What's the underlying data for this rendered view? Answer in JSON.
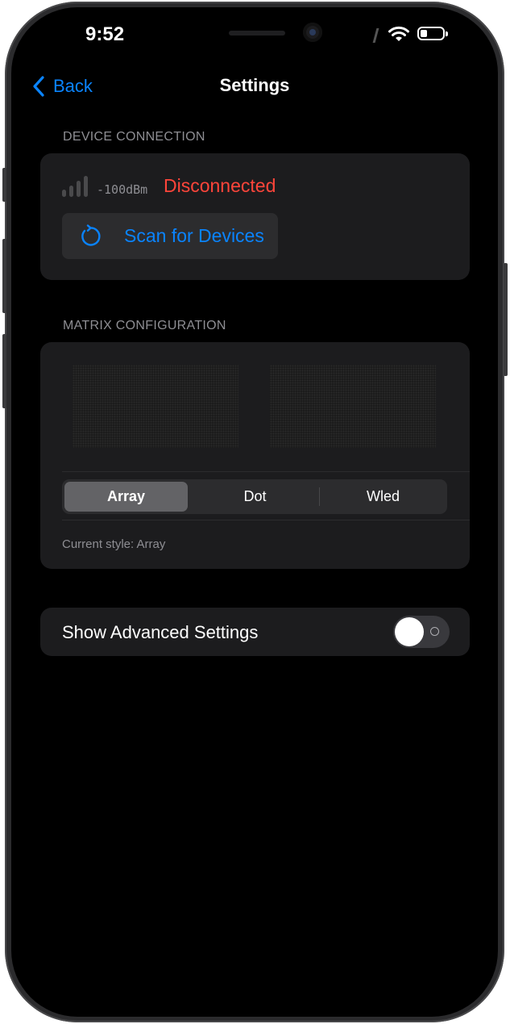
{
  "status_bar": {
    "time": "9:52",
    "icons": [
      "wifi-icon",
      "battery-icon"
    ]
  },
  "nav": {
    "back_label": "Back",
    "title": "Settings"
  },
  "device_connection": {
    "header": "DEVICE CONNECTION",
    "signal_strength_bars": 0,
    "signal_text": "-100dBm",
    "status": "Disconnected",
    "status_color": "#ff453a",
    "scan_button_label": "Scan for Devices",
    "accent_color": "#0a84ff"
  },
  "matrix_configuration": {
    "header": "MATRIX CONFIGURATION",
    "segments": [
      "Array",
      "Dot",
      "Wled"
    ],
    "selected_segment": "Array",
    "current_style_text": "Current style: Array"
  },
  "advanced": {
    "label": "Show Advanced Settings",
    "toggle_on": false
  }
}
